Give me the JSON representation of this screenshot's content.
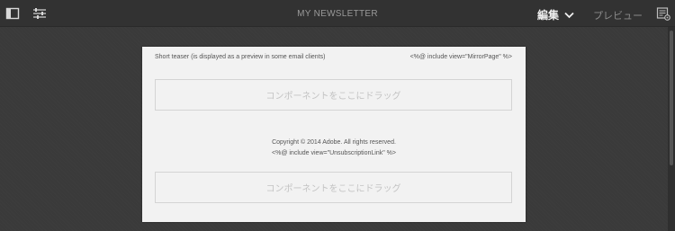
{
  "toolbar": {
    "title": "MY NEWSLETTER",
    "mode_label": "編集",
    "preview_label": "プレビュー",
    "icons": {
      "left_1": "sidebar-toggle-icon",
      "left_2": "page-properties-icon",
      "mode_dropdown": "chevron-down-icon",
      "right": "page-information-icon"
    }
  },
  "newsletter": {
    "teaser_text": "Short teaser (is displayed as a preview in some email clients)",
    "mirror_include": "<%@ include view=\"MirrorPage\" %>",
    "dropzone_top_label": "コンポーネントをここにドラッグ",
    "copyright": "Copyright © 2014 Adobe. All rights reserved.",
    "unsubscribe_include": "<%@ include view=\"UnsubscriptionLink\" %>",
    "dropzone_bottom_label": "コンポーネントをここにドラッグ"
  },
  "colors": {
    "topbar": "#323232",
    "workspace": "#3a3a3a",
    "page": "#f2f2f2",
    "dropzone_text": "#c3c3c3"
  }
}
